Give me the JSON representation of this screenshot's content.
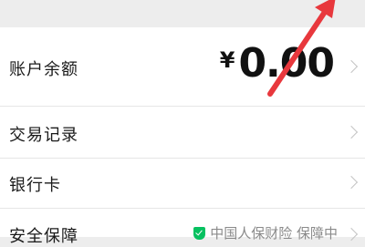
{
  "rows": {
    "balance": {
      "label": "账户余额",
      "currency": "¥",
      "amount": "0.00"
    },
    "records": {
      "label": "交易记录"
    },
    "bank_card": {
      "label": "银行卡"
    },
    "security": {
      "label": "安全保障",
      "insurance_text": "中国人保财险 保障中"
    }
  },
  "colors": {
    "arrow": "#e8383d",
    "shield": "#07c160"
  }
}
